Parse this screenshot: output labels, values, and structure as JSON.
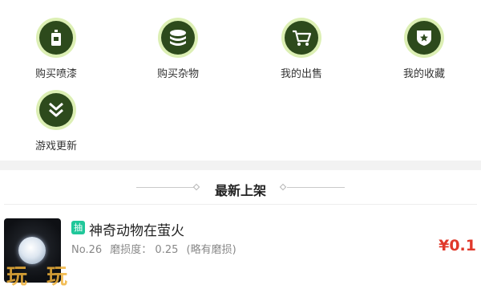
{
  "nav": {
    "items": [
      {
        "label": "购买喷漆",
        "icon": "spray-can-icon"
      },
      {
        "label": "购买杂物",
        "icon": "coin-stack-icon"
      },
      {
        "label": "我的出售",
        "icon": "shopping-cart-icon"
      },
      {
        "label": "我的收藏",
        "icon": "star-shield-icon"
      },
      {
        "label": "游戏更新",
        "icon": "double-chevron-down-icon"
      }
    ]
  },
  "section": {
    "title": "最新上架"
  },
  "listing": {
    "badge": "抽",
    "title": "神奇动物在萤火",
    "number": "No.26",
    "wear_label": "磨损度：",
    "wear_value": "0.25",
    "wear_note": "(略有磨损)",
    "price": "¥0.1",
    "watermark": "玩玩"
  },
  "colors": {
    "icon_bg": "#2d4a1c",
    "icon_ring": "#dcefb4",
    "badge": "#20c79a",
    "price": "#e0392b"
  }
}
